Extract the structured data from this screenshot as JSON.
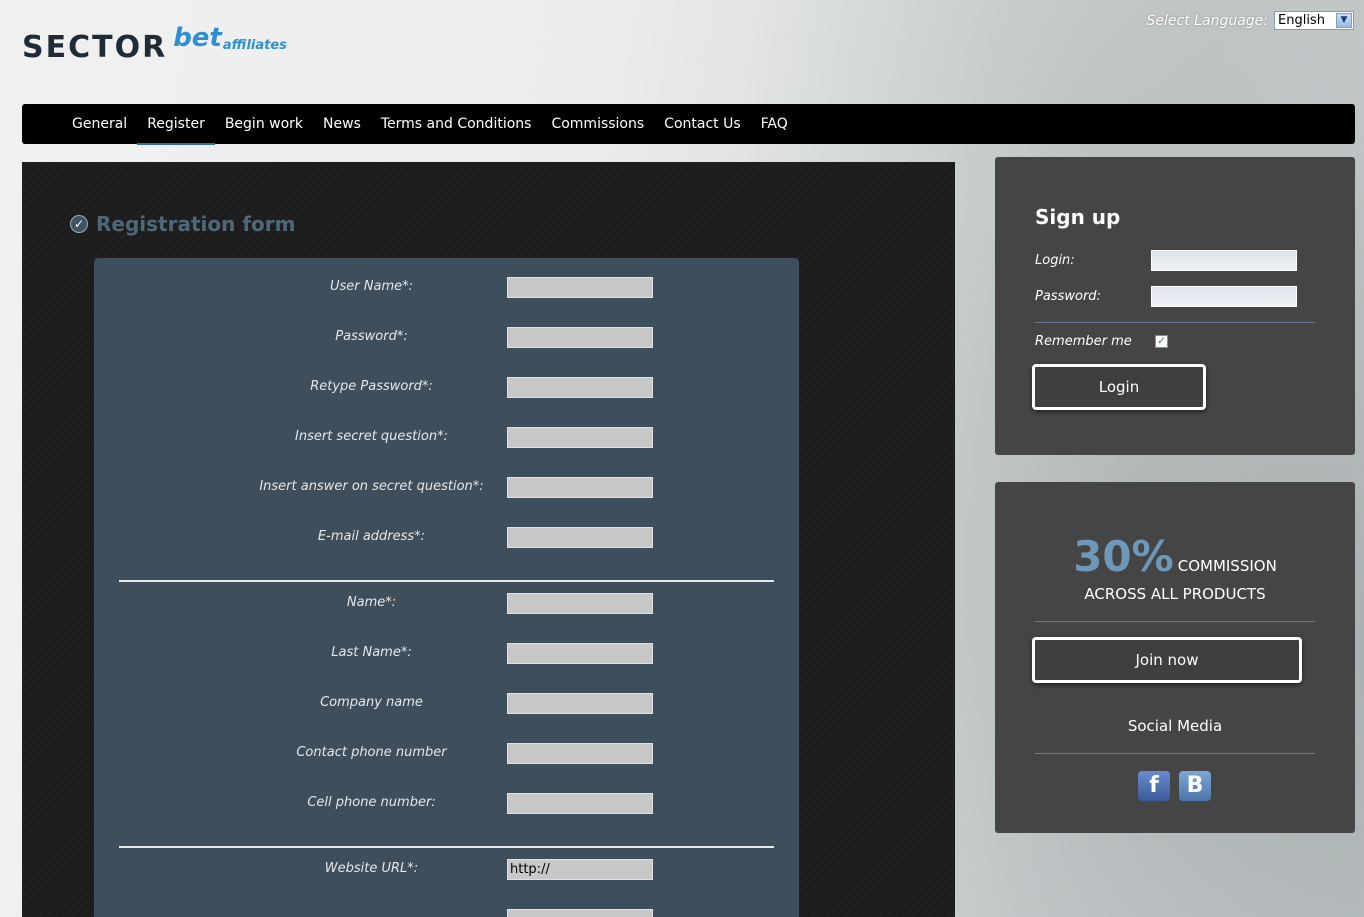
{
  "header": {
    "logo": {
      "sector": "SECTOR",
      "bet": "bet",
      "affiliates": "affiliates"
    },
    "language": {
      "label": "Select Language:",
      "selected": "English"
    }
  },
  "nav": {
    "items": [
      {
        "label": "General"
      },
      {
        "label": "Register"
      },
      {
        "label": "Begin work"
      },
      {
        "label": "News"
      },
      {
        "label": "Terms and Conditions"
      },
      {
        "label": "Commissions"
      },
      {
        "label": "Contact Us"
      },
      {
        "label": "FAQ"
      }
    ],
    "active": "Register"
  },
  "registration": {
    "title": "Registration form",
    "fields": [
      {
        "label": "User Name*:",
        "value": ""
      },
      {
        "label": "Password*:",
        "value": ""
      },
      {
        "label": "Retype Password*:",
        "value": ""
      },
      {
        "label": "Insert secret question*:",
        "value": ""
      },
      {
        "label": "Insert answer on secret question*:",
        "value": ""
      },
      {
        "label": "E-mail address*:",
        "value": ""
      },
      {
        "label": "Name*:",
        "value": ""
      },
      {
        "label": "Last Name*:",
        "value": ""
      },
      {
        "label": "Company name",
        "value": ""
      },
      {
        "label": "Contact phone number",
        "value": ""
      },
      {
        "label": "Cell phone number:",
        "value": ""
      },
      {
        "label": "Website URL*:",
        "value": "http://"
      }
    ]
  },
  "signup": {
    "title": "Sign up",
    "login_label": "Login:",
    "password_label": "Password:",
    "remember_label": "Remember me",
    "remember_checked": "✓",
    "login_button": "Login"
  },
  "promo": {
    "percent": "30%",
    "commission": "COMMISSION",
    "across": "ACROSS ALL PRODUCTS",
    "join_button": "Join now",
    "social_title": "Social Media",
    "social": [
      {
        "icon": "facebook-icon",
        "glyph": "f"
      },
      {
        "icon": "vk-icon",
        "glyph": "B"
      }
    ]
  },
  "colors": {
    "accent": "#6f97b8",
    "nav_bg": "#000000",
    "panel_bg": "#3e4e5a",
    "sidebar_bg": "#454545"
  }
}
